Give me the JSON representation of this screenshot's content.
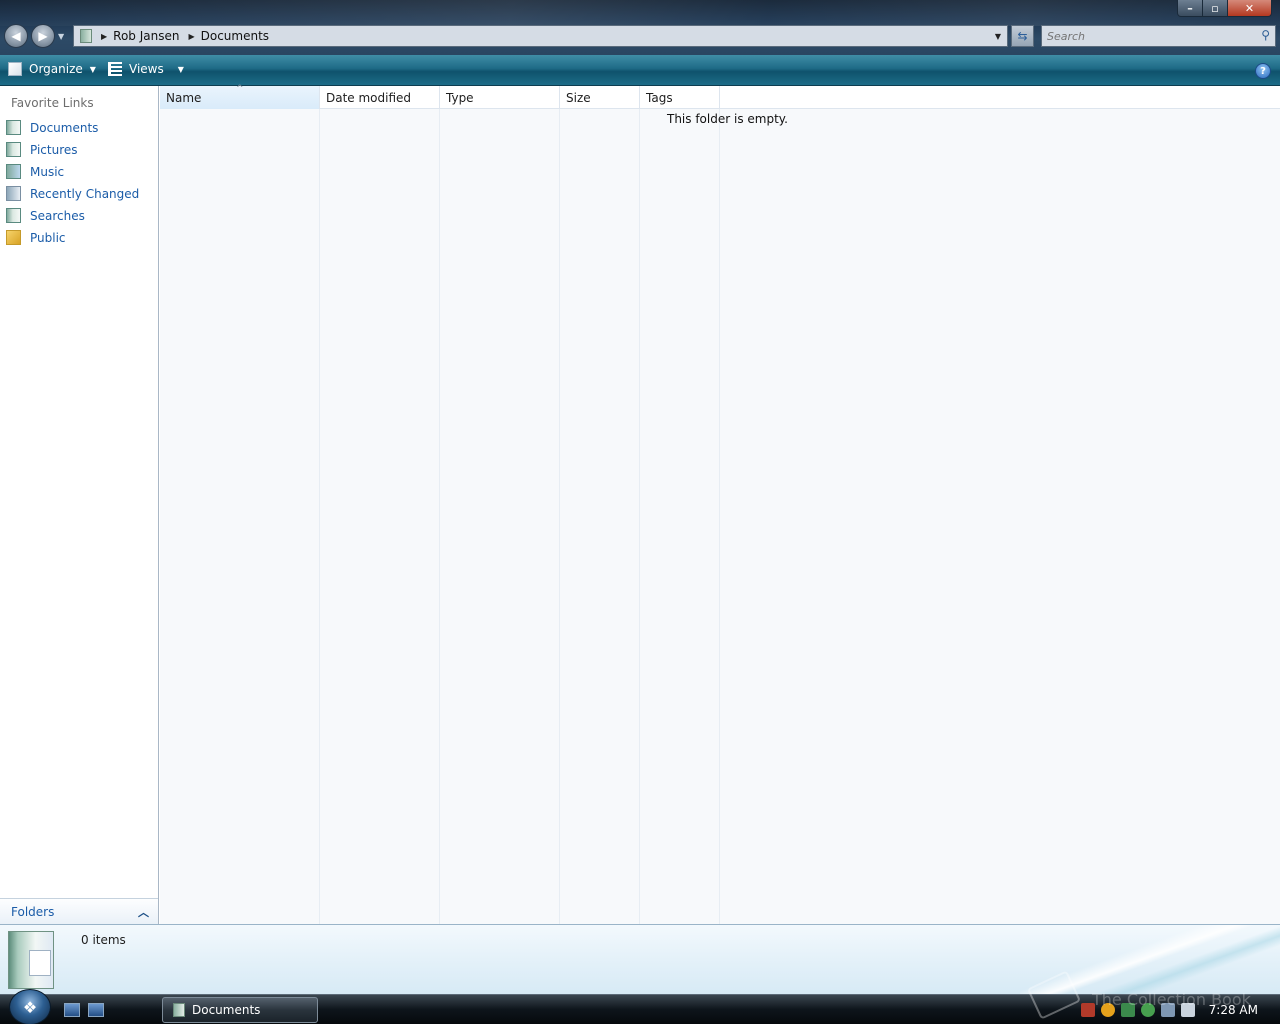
{
  "window": {
    "controls": {
      "minimize": "–",
      "maximize": "▫",
      "close": "✕"
    }
  },
  "address_bar": {
    "breadcrumbs": [
      "Rob Jansen",
      "Documents"
    ],
    "search_placeholder": "Search"
  },
  "command_bar": {
    "organize_label": "Organize",
    "views_label": "Views",
    "help_label": "?"
  },
  "nav_pane": {
    "heading": "Favorite Links",
    "links": [
      {
        "label": "Documents",
        "icon": "documents-icon"
      },
      {
        "label": "Pictures",
        "icon": "pictures-icon"
      },
      {
        "label": "Music",
        "icon": "music-icon"
      },
      {
        "label": "Recently Changed",
        "icon": "recently-changed-icon"
      },
      {
        "label": "Searches",
        "icon": "searches-icon"
      },
      {
        "label": "Public",
        "icon": "public-folder-icon"
      }
    ],
    "folders_label": "Folders"
  },
  "file_list": {
    "columns": [
      "Name",
      "Date modified",
      "Type",
      "Size",
      "Tags"
    ],
    "sorted_column": "Name",
    "empty_message": "This folder is empty."
  },
  "details_pane": {
    "item_count": "0 items"
  },
  "taskbar": {
    "task_label": "Documents",
    "clock": "7:28 AM"
  },
  "watermark": "The Collection Book",
  "colors": {
    "link": "#1b5ca8",
    "command_bar": "#1e6a86",
    "titlebar": "#1d3550"
  }
}
